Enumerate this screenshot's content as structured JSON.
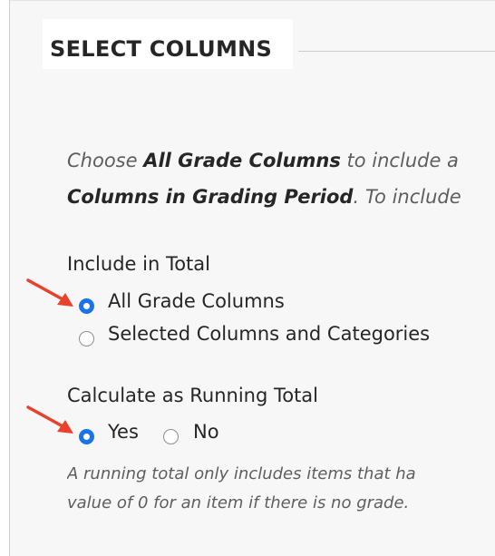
{
  "section": {
    "title": "SELECT COLUMNS"
  },
  "instructions": {
    "line1_pre": "Choose ",
    "line1_bold": "All Grade Columns",
    "line1_post": " to include a",
    "line2_bold": "Columns in Grading Period",
    "line2_post": ". To include"
  },
  "include_in_total": {
    "label": "Include in Total",
    "options": [
      {
        "label": "All Grade Columns",
        "selected": true
      },
      {
        "label": "Selected Columns and Categories",
        "selected": false
      }
    ]
  },
  "running_total": {
    "label": "Calculate as Running Total",
    "options": [
      {
        "label": "Yes",
        "selected": true
      },
      {
        "label": "No",
        "selected": false
      }
    ],
    "help_line1": "A running total only includes items that ha",
    "help_line2": "value of 0 for an item if there is no grade."
  },
  "colors": {
    "accent": "#1a73e8",
    "arrow": "#e8412c"
  }
}
